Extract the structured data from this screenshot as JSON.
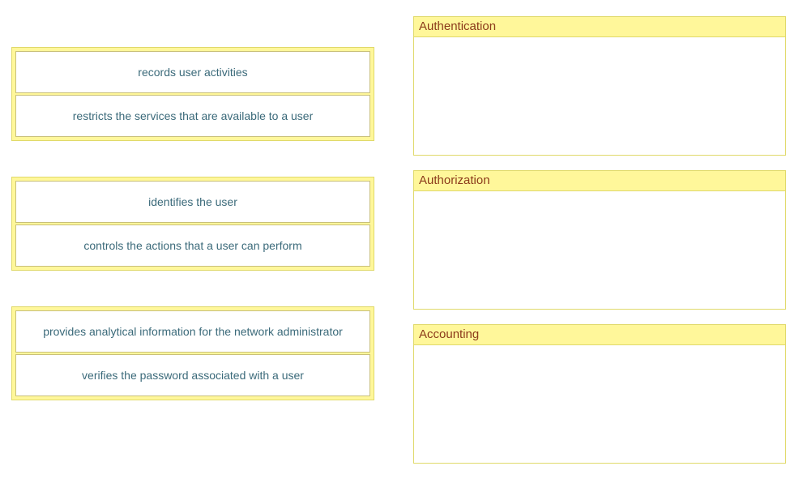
{
  "groups": [
    {
      "items": [
        {
          "text": "records user activities"
        },
        {
          "text": "restricts the services that are available to a user"
        }
      ]
    },
    {
      "items": [
        {
          "text": "identifies the user"
        },
        {
          "text": "controls the actions that a user can perform"
        }
      ]
    },
    {
      "items": [
        {
          "text": "provides analytical information for the network administrator"
        },
        {
          "text": "verifies the password associated with a user"
        }
      ]
    }
  ],
  "dropzones": [
    {
      "label": "Authentication"
    },
    {
      "label": "Authorization"
    },
    {
      "label": "Accounting"
    }
  ]
}
